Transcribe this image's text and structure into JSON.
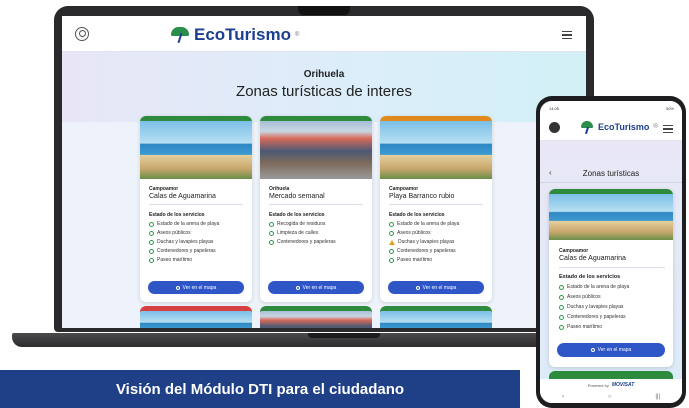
{
  "laptop": {
    "app_name": "EcoTurismo",
    "city": "Orihuela",
    "page_title": "Zonas turísticas de interes",
    "cards": [
      {
        "location": "Campoamor",
        "name": "Calas de Aguamarina",
        "accent": "#2e8b3e",
        "status_title": "Estado de los servicios",
        "services": [
          {
            "label": "Estado de la arena de playa",
            "status": "ok"
          },
          {
            "label": "Aseos públicos",
            "status": "ok"
          },
          {
            "label": "Duchas y lavapies playas",
            "status": "ok"
          },
          {
            "label": "Contenedores y papeleras",
            "status": "ok"
          },
          {
            "label": "Paseo marítimo",
            "status": "ok"
          }
        ],
        "button": "Ver en el mapa"
      },
      {
        "location": "Orihuela",
        "name": "Mercado semanal",
        "accent": "#2e8b3e",
        "status_title": "Estado de los servicios",
        "services": [
          {
            "label": "Recogida de residuos",
            "status": "ok"
          },
          {
            "label": "Limpieza de calles",
            "status": "ok"
          },
          {
            "label": "Contenedores y papeleras",
            "status": "ok"
          }
        ],
        "button": "Ver en el mapa"
      },
      {
        "location": "Campoamor",
        "name": "Playa Barranco rubio",
        "accent": "#e08a1e",
        "status_title": "Estado de los servicios",
        "services": [
          {
            "label": "Estado de la arena de playa",
            "status": "ok"
          },
          {
            "label": "Aseos públicos",
            "status": "ok"
          },
          {
            "label": "Duchas y lavapies playas",
            "status": "warning"
          },
          {
            "label": "Contenedores y papeleras",
            "status": "ok"
          },
          {
            "label": "Paseo marítimo",
            "status": "ok"
          }
        ],
        "button": "Ver en el mapa"
      }
    ],
    "next_row_accents": [
      "#d64040",
      "#2e8b3e",
      "#2e8b3e"
    ]
  },
  "phone": {
    "status_time": "14:05",
    "status_right": "50%",
    "app_name": "EcoTurismo",
    "back_label": "‹",
    "section_title": "Zonas turísticas",
    "card": {
      "location": "Campoamor",
      "name": "Calas de Aguamarina",
      "status_title": "Estado de los servicios",
      "services": [
        "Estado de la arena de playa",
        "Aseos públicos",
        "Duchas y lavapies playas",
        "Contenedores y papeleras",
        "Paseo marítimo"
      ],
      "button": "Ver en el mapa"
    },
    "footer_prefix": "Powered by",
    "footer_brand": "MOVISAT",
    "nav_buttons": [
      "‹",
      "○",
      "|||"
    ]
  },
  "caption": "Visión del Módulo DTI para el ciudadano"
}
